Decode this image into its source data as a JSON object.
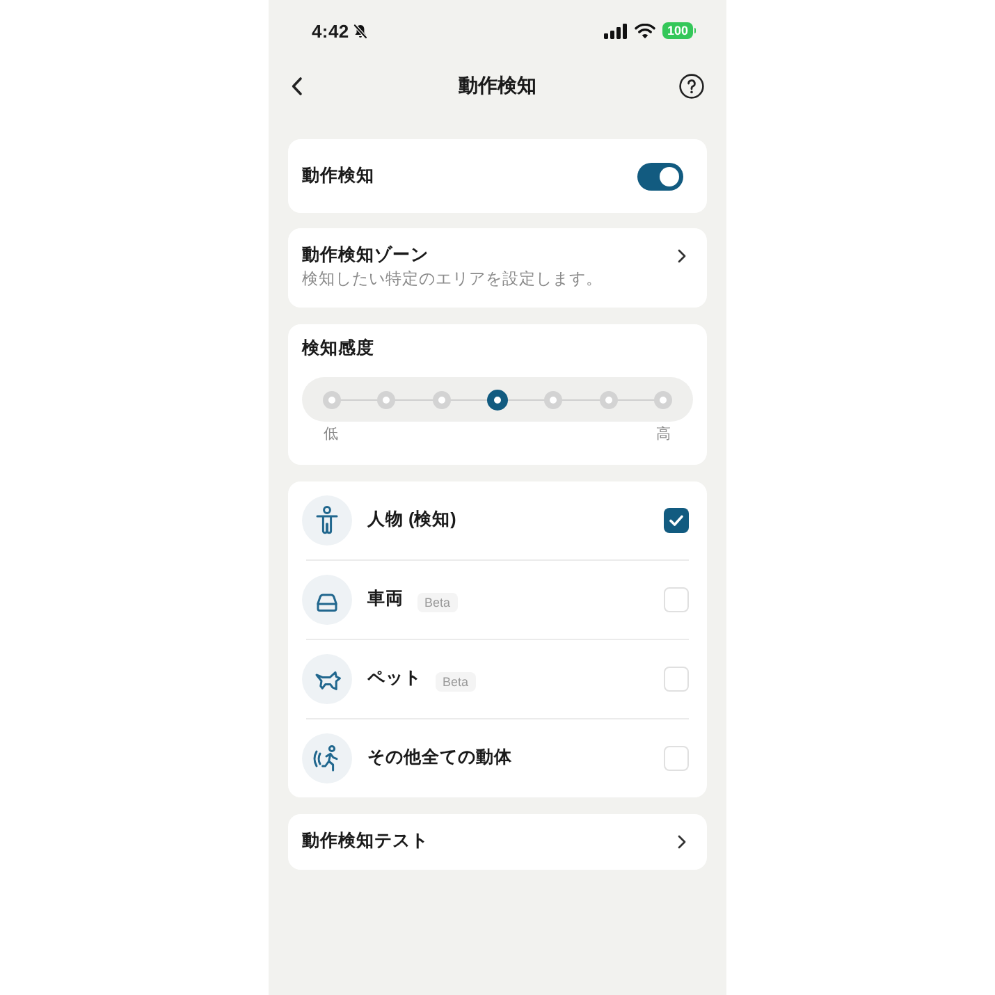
{
  "status_bar": {
    "time": "4:42",
    "battery": "100"
  },
  "header": {
    "title": "動作検知"
  },
  "motion_detection": {
    "label": "動作検知",
    "on": true
  },
  "detection_zone": {
    "title": "動作検知ゾーン",
    "subtitle": "検知したい特定のエリアを設定します。"
  },
  "sensitivity": {
    "title": "検知感度",
    "level": 0.5,
    "low_label": "低",
    "high_label": "高"
  },
  "detection_targets": [
    {
      "label": "人物 (検知)",
      "checked": true
    },
    {
      "label": "車両",
      "badge": "Beta",
      "checked": false
    },
    {
      "label": "ペット",
      "badge": "Beta",
      "checked": false
    },
    {
      "label": "その他全ての動体",
      "checked": false
    }
  ],
  "motion_test": {
    "label": "動作検知テスト"
  }
}
